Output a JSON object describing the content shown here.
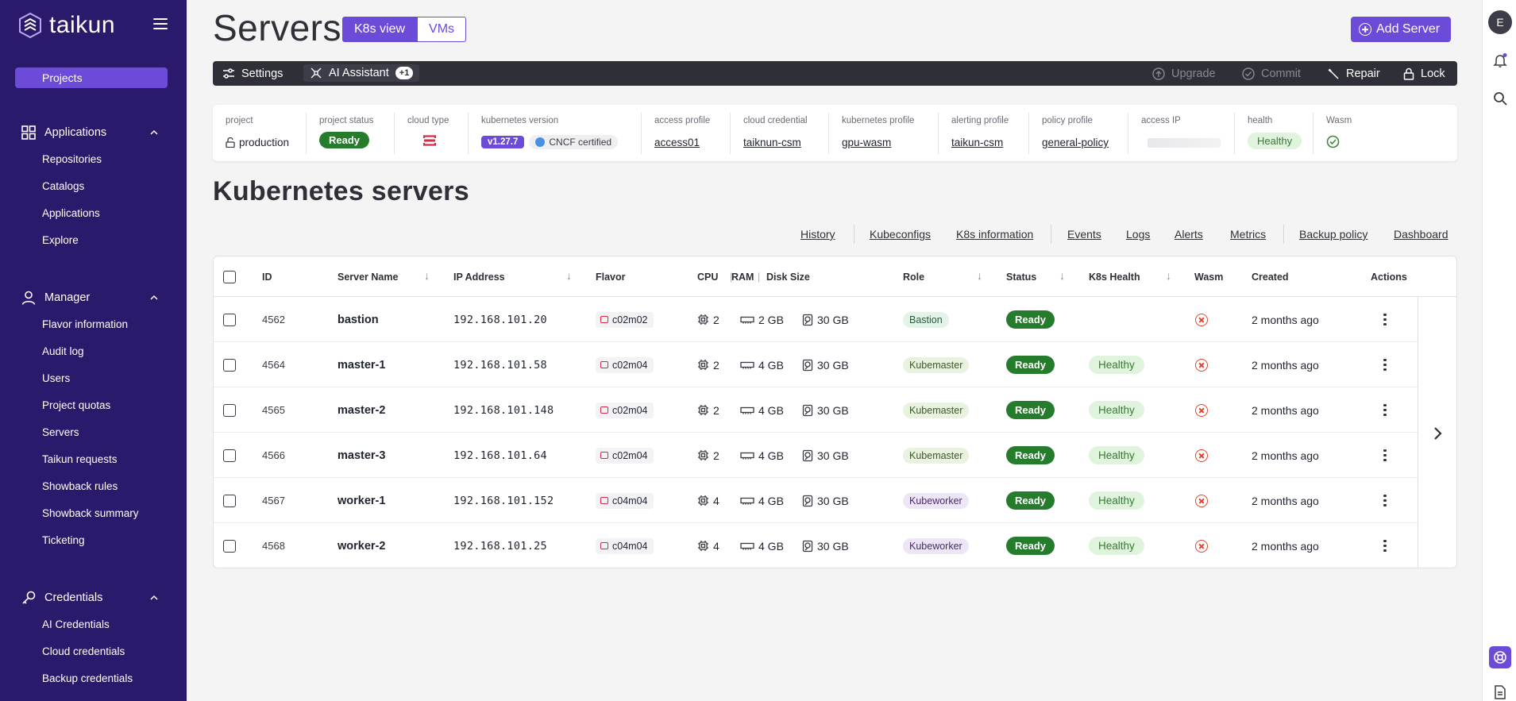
{
  "brand": {
    "name": "taikun"
  },
  "sidebar": {
    "projects_label": "Projects",
    "groups": [
      {
        "title": "Applications",
        "items": [
          "Repositories",
          "Catalogs",
          "Applications",
          "Explore"
        ]
      },
      {
        "title": "Manager",
        "items": [
          "Flavor information",
          "Audit log",
          "Users",
          "Project quotas",
          "Servers",
          "Taikun requests",
          "Showback rules",
          "Showback summary",
          "Ticketing"
        ]
      },
      {
        "title": "Credentials",
        "items": [
          "AI Credentials",
          "Cloud credentials",
          "Backup credentials"
        ]
      }
    ]
  },
  "header": {
    "title": "Servers",
    "views": [
      "K8s view",
      "VMs"
    ],
    "add_server": "Add Server"
  },
  "toolbar": {
    "settings": "Settings",
    "ai_assistant": "AI Assistant",
    "ai_badge": "+1",
    "upgrade": "Upgrade",
    "commit": "Commit",
    "repair": "Repair",
    "lock": "Lock"
  },
  "info": {
    "project_label": "project",
    "project_value": "production",
    "status_label": "project status",
    "status_value": "Ready",
    "cloud_label": "cloud type",
    "k8s_label": "kubernetes version",
    "k8s_value": "v1.27.7",
    "cncf": "CNCF certified",
    "access_profile_label": "access profile",
    "access_profile_value": "access01",
    "cloud_cred_label": "cloud credential",
    "cloud_cred_value": "taiknun-csm",
    "k8s_profile_label": "kubernetes profile",
    "k8s_profile_value": "gpu-wasm",
    "alert_label": "alerting profile",
    "alert_value": "taikun-csm",
    "policy_label": "policy profile",
    "policy_value": "general-policy",
    "access_ip_label": "access IP",
    "health_label": "health",
    "health_value": "Healthy",
    "wasm_label": "Wasm"
  },
  "section": {
    "title": "Kubernetes servers",
    "links": [
      "History",
      "Kubeconfigs",
      "K8s information",
      "Events",
      "Logs",
      "Alerts",
      "Metrics",
      "Backup policy",
      "Dashboard"
    ]
  },
  "table": {
    "columns": {
      "id": "ID",
      "name": "Server Name",
      "ip": "IP Address",
      "flavor": "Flavor",
      "cpu": "CPU",
      "ram": "RAM",
      "disk": "Disk Size",
      "role": "Role",
      "status": "Status",
      "health": "K8s Health",
      "wasm": "Wasm",
      "created": "Created",
      "actions": "Actions"
    },
    "rows": [
      {
        "id": "4562",
        "name": "bastion",
        "ip": "192.168.101.20",
        "flavor": "c02m02",
        "cpu": "2",
        "ram": "2 GB",
        "disk": "30 GB",
        "role": "Bastion",
        "status": "Ready",
        "health": "",
        "created": "2 months ago"
      },
      {
        "id": "4564",
        "name": "master-1",
        "ip": "192.168.101.58",
        "flavor": "c02m04",
        "cpu": "2",
        "ram": "4 GB",
        "disk": "30 GB",
        "role": "Kubemaster",
        "status": "Ready",
        "health": "Healthy",
        "created": "2 months ago"
      },
      {
        "id": "4565",
        "name": "master-2",
        "ip": "192.168.101.148",
        "flavor": "c02m04",
        "cpu": "2",
        "ram": "4 GB",
        "disk": "30 GB",
        "role": "Kubemaster",
        "status": "Ready",
        "health": "Healthy",
        "created": "2 months ago"
      },
      {
        "id": "4566",
        "name": "master-3",
        "ip": "192.168.101.64",
        "flavor": "c02m04",
        "cpu": "2",
        "ram": "4 GB",
        "disk": "30 GB",
        "role": "Kubemaster",
        "status": "Ready",
        "health": "Healthy",
        "created": "2 months ago"
      },
      {
        "id": "4567",
        "name": "worker-1",
        "ip": "192.168.101.152",
        "flavor": "c04m04",
        "cpu": "4",
        "ram": "4 GB",
        "disk": "30 GB",
        "role": "Kubeworker",
        "status": "Ready",
        "health": "Healthy",
        "created": "2 months ago"
      },
      {
        "id": "4568",
        "name": "worker-2",
        "ip": "192.168.101.25",
        "flavor": "c04m04",
        "cpu": "4",
        "ram": "4 GB",
        "disk": "30 GB",
        "role": "Kubeworker",
        "status": "Ready",
        "health": "Healthy",
        "created": "2 months ago"
      }
    ]
  },
  "user": {
    "initial": "E"
  },
  "colors": {
    "sidebar": "#2b1a6b",
    "accent": "#6c4bd8",
    "ready": "#267c2d",
    "danger": "#e0442c"
  }
}
